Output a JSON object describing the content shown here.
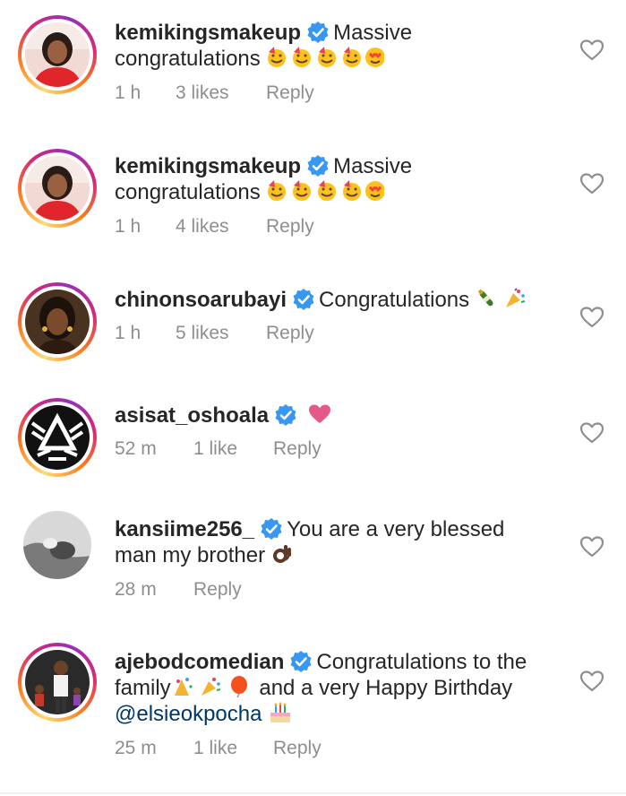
{
  "comments": [
    {
      "username": "kemikingsmakeup",
      "text": "Massive",
      "text2": "congratulations",
      "time": "1 h",
      "likes": "3 likes",
      "reply": "Reply"
    },
    {
      "username": "kemikingsmakeup",
      "text": "Massive",
      "text2": "congratulations",
      "time": "1 h",
      "likes": "4 likes",
      "reply": "Reply"
    },
    {
      "username": "chinonsoarubayi",
      "text": "Congratulations",
      "time": "1 h",
      "likes": "5 likes",
      "reply": "Reply"
    },
    {
      "username": "asisat_oshoala",
      "time": "52 m",
      "likes": "1 like",
      "reply": "Reply"
    },
    {
      "username": "kansiime256_",
      "text": "You are a very blessed",
      "text2": "man my brother",
      "time": "28 m",
      "reply": "Reply"
    },
    {
      "username": "ajebodcomedian",
      "text": "Congratulations to the",
      "text2a": "family",
      "text2b": "and a very Happy Birthday",
      "mention": "@elsieokpocha",
      "time": "25 m",
      "likes": "1 like",
      "reply": "Reply"
    }
  ],
  "colors": {
    "text": "#262626",
    "meta": "#8e8e8e",
    "verified": "#3897f0",
    "mention": "#00376b"
  },
  "icons": {
    "verified": "verified-badge-icon",
    "like": "heart-outline-icon"
  }
}
